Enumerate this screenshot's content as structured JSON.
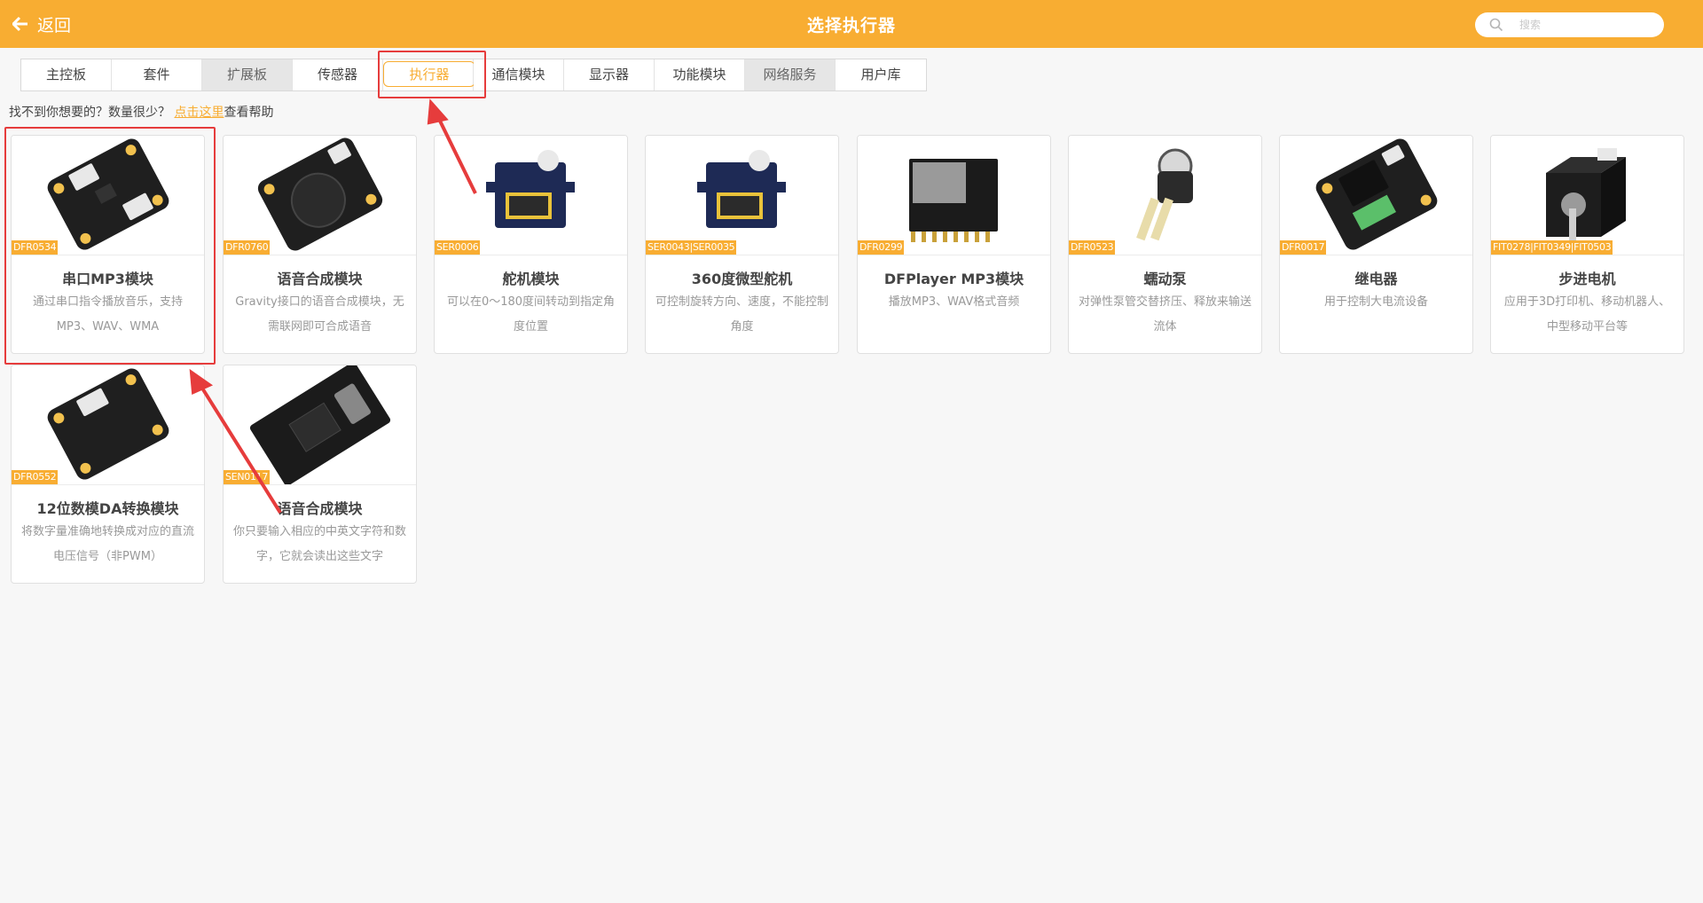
{
  "header": {
    "back_label": "返回",
    "title": "选择执行器",
    "search_placeholder": "搜索"
  },
  "tabs": [
    {
      "label": "主控板",
      "state": "normal"
    },
    {
      "label": "套件",
      "state": "normal"
    },
    {
      "label": "扩展板",
      "state": "gray"
    },
    {
      "label": "传感器",
      "state": "normal"
    },
    {
      "label": "执行器",
      "state": "active"
    },
    {
      "label": "通信模块",
      "state": "normal"
    },
    {
      "label": "显示器",
      "state": "normal"
    },
    {
      "label": "功能模块",
      "state": "normal"
    },
    {
      "label": "网络服务",
      "state": "gray"
    },
    {
      "label": "用户库",
      "state": "normal"
    }
  ],
  "help": {
    "prefix": "找不到你想要的？数量很少？",
    "link": "点击这里",
    "suffix": "查看帮助"
  },
  "cards": [
    {
      "sku": "DFR0534",
      "name": "串口MP3模块",
      "desc": "通过串口指令播放音乐，支持MP3、WAV、WMA",
      "icon": "mp3-board-icon"
    },
    {
      "sku": "DFR0760",
      "name": "语音合成模块",
      "desc": "Gravity接口的语音合成模块，无需联网即可合成语音",
      "icon": "speaker-board-icon"
    },
    {
      "sku": "SER0006",
      "name": "舵机模块",
      "desc": "可以在0～180度间转动到指定角度位置",
      "icon": "servo-icon"
    },
    {
      "sku": "SER0043|SER0035",
      "name": "360度微型舵机",
      "desc": "可控制旋转方向、速度，不能控制角度",
      "icon": "servo-icon"
    },
    {
      "sku": "DFR0299",
      "name": "DFPlayer MP3模块",
      "desc": "播放MP3、WAV格式音频",
      "icon": "dfplayer-icon"
    },
    {
      "sku": "DFR0523",
      "name": "蠕动泵",
      "desc": "对弹性泵管交替挤压、释放来输送流体",
      "icon": "pump-icon"
    },
    {
      "sku": "DFR0017",
      "name": "继电器",
      "desc": "用于控制大电流设备",
      "icon": "relay-icon"
    },
    {
      "sku": "FIT0278|FIT0349|FIT0503",
      "name": "步进电机",
      "desc": "应用于3D打印机、移动机器人、中型移动平台等",
      "icon": "stepper-motor-icon"
    },
    {
      "sku": "DFR0552",
      "name": "12位数模DA转换模块",
      "desc": "将数字量准确地转换成对应的直流电压信号（非PWM）",
      "icon": "dac-board-icon"
    },
    {
      "sku": "SEN0117",
      "name": "语音合成模块",
      "desc": "你只要输入相应的中英文字符和数字，它就会读出这些文字",
      "icon": "speech-synth-board-icon"
    }
  ],
  "colors": {
    "accent": "#f8ad32",
    "highlight": "#e63c3c"
  }
}
